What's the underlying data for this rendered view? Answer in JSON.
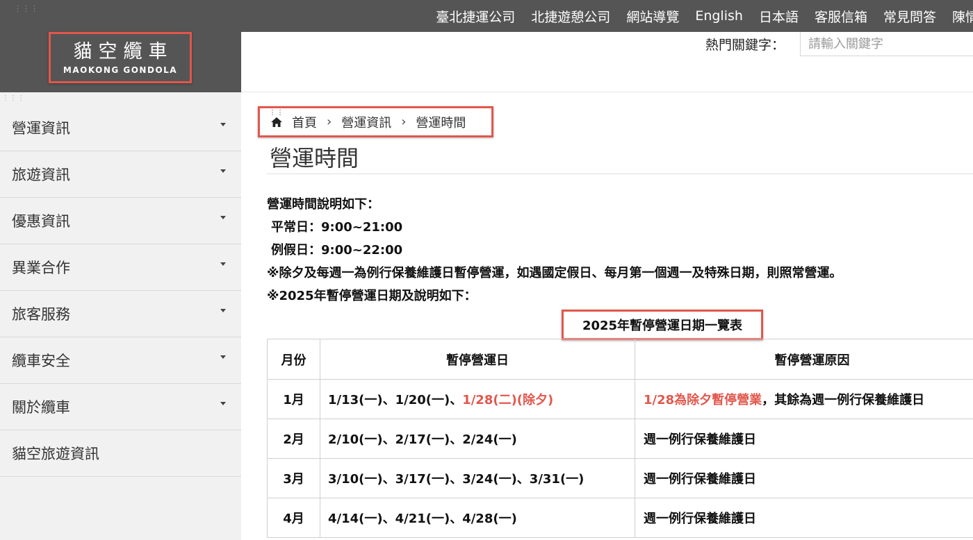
{
  "top_nav": [
    "臺北捷運公司",
    "北捷遊憩公司",
    "網站導覽",
    "English",
    "日本語",
    "客服信箱",
    "常見問答",
    "陳情"
  ],
  "logo": {
    "zh": "貓空纜車",
    "en": "MAOKONG GONDOLA"
  },
  "search": {
    "label": "熱門關鍵字：",
    "placeholder": "請輸入關鍵字"
  },
  "sidebar": {
    "items": [
      {
        "label": "營運資訊",
        "has_dropdown": true
      },
      {
        "label": "旅遊資訊",
        "has_dropdown": true
      },
      {
        "label": "優惠資訊",
        "has_dropdown": true
      },
      {
        "label": "異業合作",
        "has_dropdown": true
      },
      {
        "label": "旅客服務",
        "has_dropdown": true
      },
      {
        "label": "纜車安全",
        "has_dropdown": true
      },
      {
        "label": "關於纜車",
        "has_dropdown": true
      },
      {
        "label": "貓空旅遊資訊",
        "has_dropdown": false
      }
    ]
  },
  "breadcrumb": {
    "home": "首頁",
    "section": "營運資訊",
    "current": "營運時間"
  },
  "page_title": "營運時間",
  "info": {
    "intro": "營運時間說明如下：",
    "weekday": "平常日：9:00~21:00",
    "holiday": "例假日：9:00~22:00",
    "note1": "※除夕及每週一為例行保養維護日暫停營運，如遇國定假日、每月第一個週一及特殊日期，則照常營運。",
    "note2": "※2025年暫停營運日期及說明如下："
  },
  "table": {
    "caption": "2025年暫停營運日期一覽表",
    "headers": [
      "月份",
      "暫停營運日",
      "暫停營運原因"
    ],
    "rows": [
      {
        "month": "1月",
        "dates": "1/13(一)、1/20(一)、",
        "dates_highlight": "1/28(二)(除夕)",
        "reason_highlight": "1/28為除夕暫停營業",
        "reason": "，其餘為週一例行保養維護日"
      },
      {
        "month": "2月",
        "dates": "2/10(一)、2/17(一)、2/24(一)",
        "dates_highlight": "",
        "reason_highlight": "",
        "reason": "週一例行保養維護日"
      },
      {
        "month": "3月",
        "dates": "3/10(一)、3/17(一)、3/24(一)、3/31(一)",
        "dates_highlight": "",
        "reason_highlight": "",
        "reason": "週一例行保養維護日"
      },
      {
        "month": "4月",
        "dates": "4/14(一)、4/21(一)、4/28(一)",
        "dates_highlight": "",
        "reason_highlight": "",
        "reason": "週一例行保養維護日"
      }
    ]
  },
  "colors": {
    "header_bg": "#555555",
    "sidebar_bg": "#f1f1f1",
    "highlight_red": "#e2574c",
    "annotation_box": "#e2574c"
  },
  "icons": {
    "home": "home-icon",
    "caret": "caret-down-icon",
    "separator": "chevron-right"
  }
}
